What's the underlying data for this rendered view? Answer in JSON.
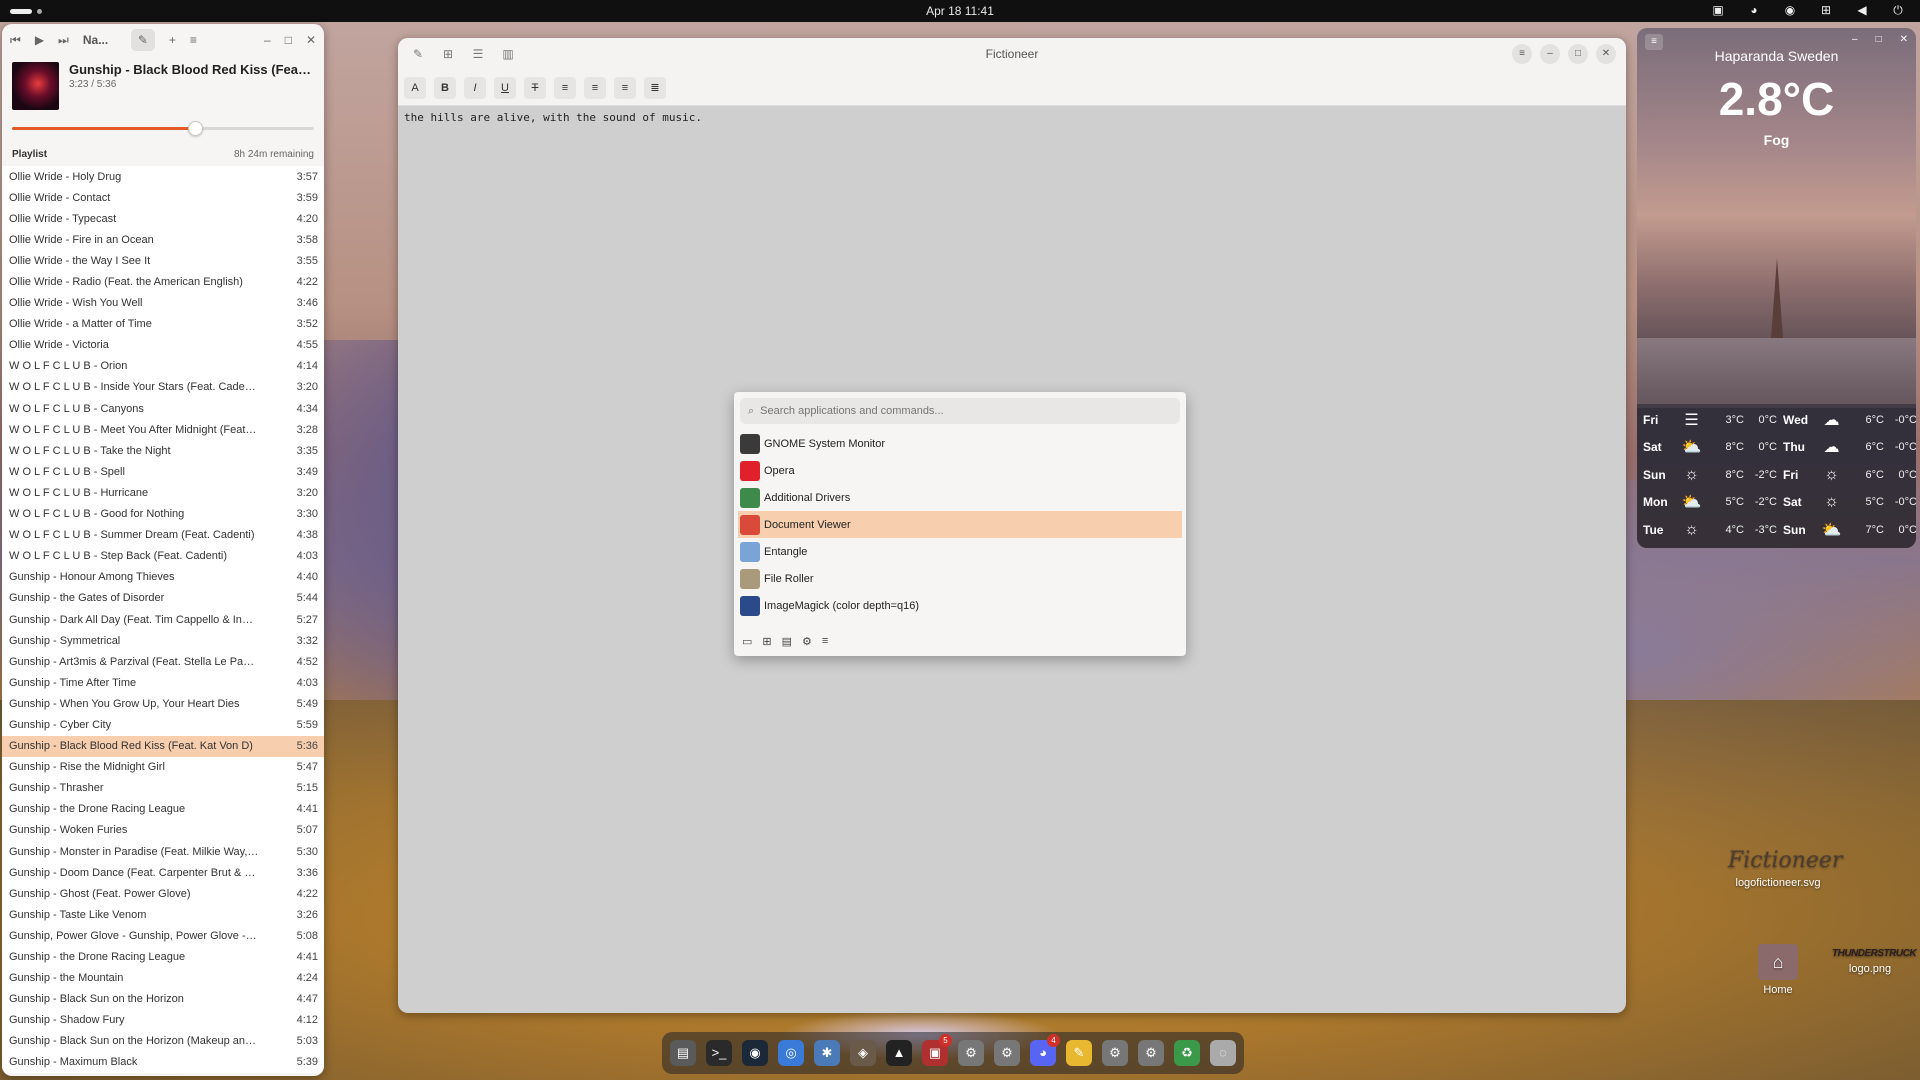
{
  "topbar": {
    "clock": "Apr 18  11:41"
  },
  "player": {
    "header_title": "Na...",
    "now_playing": {
      "title": "Gunship - Black Blood Red Kiss (Feat. Kat Von D)",
      "time": "3:23 / 5:36",
      "progress": 0.605
    },
    "playlist_label": "Playlist",
    "remaining": "8h 24m remaining",
    "tracks": [
      {
        "name": "Ollie Wride - Holy Drug",
        "dur": "3:57"
      },
      {
        "name": "Ollie Wride - Contact",
        "dur": "3:59"
      },
      {
        "name": "Ollie Wride - Typecast",
        "dur": "4:20"
      },
      {
        "name": "Ollie Wride - Fire in an Ocean",
        "dur": "3:58"
      },
      {
        "name": "Ollie Wride - the Way I See It",
        "dur": "3:55"
      },
      {
        "name": "Ollie Wride - Radio (Feat. the American English)",
        "dur": "4:22"
      },
      {
        "name": "Ollie Wride - Wish You Well",
        "dur": "3:46"
      },
      {
        "name": "Ollie Wride - a Matter of Time",
        "dur": "3:52"
      },
      {
        "name": "Ollie Wride - Victoria",
        "dur": "4:55"
      },
      {
        "name": "W O L F C L U B - Orion",
        "dur": "4:14"
      },
      {
        "name": "W O L F C L U B - Inside Your Stars (Feat. Cadenti)",
        "dur": "3:20"
      },
      {
        "name": "W O L F C L U B - Canyons",
        "dur": "4:34"
      },
      {
        "name": "W O L F C L U B - Meet You After Midnight (Feat. Cadenti)",
        "dur": "3:28"
      },
      {
        "name": "W O L F C L U B - Take the Night",
        "dur": "3:35"
      },
      {
        "name": "W O L F C L U B - Spell",
        "dur": "3:49"
      },
      {
        "name": "W O L F C L U B - Hurricane",
        "dur": "3:20"
      },
      {
        "name": "W O L F C L U B - Good for Nothing",
        "dur": "3:30"
      },
      {
        "name": "W O L F C L U B - Summer Dream (Feat. Cadenti)",
        "dur": "4:38"
      },
      {
        "name": "W O L F C L U B - Step Back (Feat. Cadenti)",
        "dur": "4:03"
      },
      {
        "name": "Gunship - Honour Among Thieves",
        "dur": "4:40"
      },
      {
        "name": "Gunship - the Gates of Disorder",
        "dur": "5:44"
      },
      {
        "name": "Gunship - Dark All Day (Feat. Tim Cappello & Indiana)",
        "dur": "5:27"
      },
      {
        "name": "Gunship - Symmetrical",
        "dur": "3:32"
      },
      {
        "name": "Gunship - Art3mis & Parzival (Feat. Stella Le Page)",
        "dur": "4:52"
      },
      {
        "name": "Gunship - Time After Time",
        "dur": "4:03"
      },
      {
        "name": "Gunship - When You Grow Up, Your Heart Dies",
        "dur": "5:49"
      },
      {
        "name": "Gunship - Cyber City",
        "dur": "5:59"
      },
      {
        "name": "Gunship - Black Blood Red Kiss (Feat. Kat Von D)",
        "dur": "5:36",
        "active": true
      },
      {
        "name": "Gunship - Rise the Midnight Girl",
        "dur": "5:47"
      },
      {
        "name": "Gunship - Thrasher",
        "dur": "5:15"
      },
      {
        "name": "Gunship - the Drone Racing League",
        "dur": "4:41"
      },
      {
        "name": "Gunship - Woken Furies",
        "dur": "5:07"
      },
      {
        "name": "Gunship - Monster in Paradise (Feat. Milkie Way, Dave L...",
        "dur": "5:30"
      },
      {
        "name": "Gunship - Doom Dance (Feat. Carpenter Brut & Gavin R...",
        "dur": "3:36"
      },
      {
        "name": "Gunship - Ghost (Feat. Power Glove)",
        "dur": "4:22"
      },
      {
        "name": "Gunship - Taste Like Venom",
        "dur": "3:26"
      },
      {
        "name": "Gunship, Power Glove - Gunship, Power Glove - Dark All ...",
        "dur": "5:08"
      },
      {
        "name": "Gunship - the Drone Racing League",
        "dur": "4:41"
      },
      {
        "name": "Gunship - the Mountain",
        "dur": "4:24"
      },
      {
        "name": "Gunship - Black Sun on the Horizon",
        "dur": "4:47"
      },
      {
        "name": "Gunship - Shadow Fury",
        "dur": "4:12"
      },
      {
        "name": "Gunship - Black Sun on the Horizon (Makeup and Vanity ...",
        "dur": "5:03"
      },
      {
        "name": "Gunship - Maximum Black",
        "dur": "5:39"
      }
    ]
  },
  "fictioneer": {
    "title": "Fictioneer",
    "text": "the hills are alive, with the sound of music.",
    "toolbar": {
      "bold": "B",
      "italic": "I",
      "underline": "U",
      "strike": "T"
    }
  },
  "launcher": {
    "search_placeholder": "Search applications and commands...",
    "items": [
      {
        "label": "GNOME System Monitor",
        "icon": "monitor-icon",
        "color": "#3a3a3a"
      },
      {
        "label": "Opera",
        "icon": "opera-icon",
        "color": "#e0202a"
      },
      {
        "label": "Additional Drivers",
        "icon": "chip-icon",
        "color": "#3e8a4a"
      },
      {
        "label": "Document Viewer",
        "icon": "document-icon",
        "color": "#d94a3a",
        "active": true
      },
      {
        "label": "Entangle",
        "icon": "camera-icon",
        "color": "#7aa3d6"
      },
      {
        "label": "File Roller",
        "icon": "archive-icon",
        "color": "#a89a7a"
      },
      {
        "label": "ImageMagick (color depth=q16)",
        "icon": "wand-icon",
        "color": "#2a4a8a"
      }
    ]
  },
  "weather": {
    "city": "Haparanda Sweden",
    "temp": "2.8°C",
    "condition": "Fog",
    "forecast_left": [
      {
        "day": "Fri",
        "hi": "3°C",
        "lo": "0°C",
        "icon": "fog-icon"
      },
      {
        "day": "Sat",
        "hi": "8°C",
        "lo": "0°C",
        "icon": "partly-cloudy-icon"
      },
      {
        "day": "Sun",
        "hi": "8°C",
        "lo": "-2°C",
        "icon": "sun-icon"
      },
      {
        "day": "Mon",
        "hi": "5°C",
        "lo": "-2°C",
        "icon": "partly-cloudy-icon"
      },
      {
        "day": "Tue",
        "hi": "4°C",
        "lo": "-3°C",
        "icon": "sun-icon"
      }
    ],
    "forecast_right": [
      {
        "day": "Wed",
        "hi": "6°C",
        "lo": "-0°C",
        "icon": "cloud-icon"
      },
      {
        "day": "Thu",
        "hi": "6°C",
        "lo": "-0°C",
        "icon": "cloud-icon"
      },
      {
        "day": "Fri",
        "hi": "6°C",
        "lo": "0°C",
        "icon": "sun-icon"
      },
      {
        "day": "Sat",
        "hi": "5°C",
        "lo": "-0°C",
        "icon": "sun-icon"
      },
      {
        "day": "Sun",
        "hi": "7°C",
        "lo": "0°C",
        "icon": "partly-cloudy-icon"
      }
    ]
  },
  "desktop": {
    "logo_label": "logofictioneer.svg",
    "logo_text": "Fictioneer",
    "home_label": "Home",
    "png_label": "logo.png",
    "png_text": "THUNDERSTRUCK"
  },
  "dock": {
    "items": [
      {
        "name": "files-icon",
        "color": "#5a5a5a",
        "glyph": "▤"
      },
      {
        "name": "terminal-icon",
        "color": "#2a2a2a",
        "glyph": ">_"
      },
      {
        "name": "steam-icon",
        "color": "#1b2838",
        "glyph": "◉"
      },
      {
        "name": "chrome-icon",
        "color": "#3a7ad8",
        "glyph": "◎"
      },
      {
        "name": "gear-wheel-icon",
        "color": "#4a7ab8",
        "glyph": "✱"
      },
      {
        "name": "gimp-icon",
        "color": "#6a5a4a",
        "glyph": "◈"
      },
      {
        "name": "inkscape-icon",
        "color": "#222",
        "glyph": "▲"
      },
      {
        "name": "notes-icon",
        "color": "#b03030",
        "glyph": "▣",
        "badge": "5"
      },
      {
        "name": "settings-icon",
        "color": "#777",
        "glyph": "⚙"
      },
      {
        "name": "settings-icon-2",
        "color": "#777",
        "glyph": "⚙"
      },
      {
        "name": "discord-icon",
        "color": "#5865f2",
        "glyph": "◕",
        "badge": "4"
      },
      {
        "name": "text-editor-icon",
        "color": "#e8b830",
        "glyph": "✎"
      },
      {
        "name": "settings-icon-3",
        "color": "#777",
        "glyph": "⚙"
      },
      {
        "name": "settings-icon-4",
        "color": "#777",
        "glyph": "⚙"
      },
      {
        "name": "recycle-icon",
        "color": "#3a9a4a",
        "glyph": "♻"
      },
      {
        "name": "loading-icon",
        "color": "#aaa",
        "glyph": "◌"
      }
    ]
  }
}
